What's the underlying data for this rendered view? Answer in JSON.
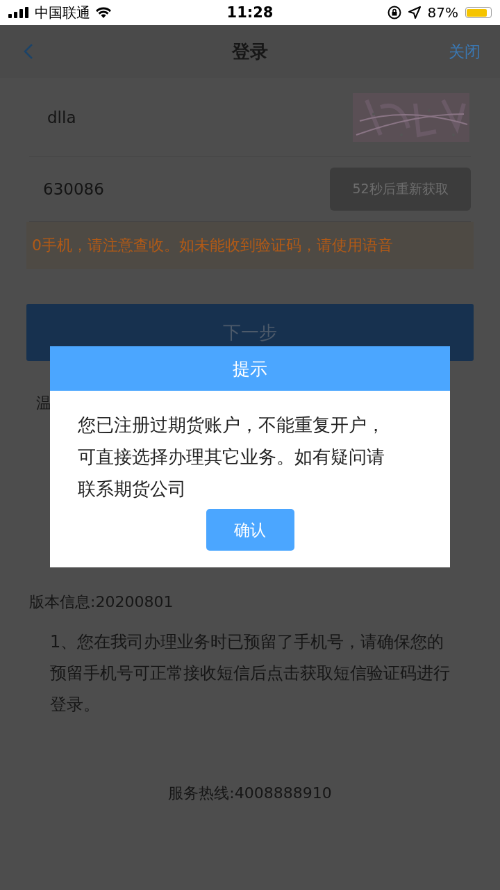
{
  "status_bar": {
    "carrier": "中国联通",
    "time": "11:28",
    "battery_text": "87%",
    "battery": {
      "level": 0.87
    }
  },
  "nav": {
    "title": "登录",
    "close": "关闭"
  },
  "captcha_field": {
    "value": "dlla"
  },
  "sms_field": {
    "value": "630086",
    "resend": "52秒后重新获取",
    "resend_disabled": true
  },
  "notice": "0手机，请注意查收。如未能收到验证码，请使用语音",
  "next_button": "下一步",
  "tips_heading": "温",
  "version": "版本信息:20200801",
  "tip": "1、您在我司办理业务时已预留了手机号，请确保您的预留手机号可正常接收短信后点击获取短信验证码进行登录。",
  "hotline": "服务热线:4008888910",
  "dialog": {
    "title": "提示",
    "message": "您已注册过期货账户，不能重复开户，可直接选择办理其它业务。如有疑问请联系期货公司",
    "button": "确认"
  }
}
